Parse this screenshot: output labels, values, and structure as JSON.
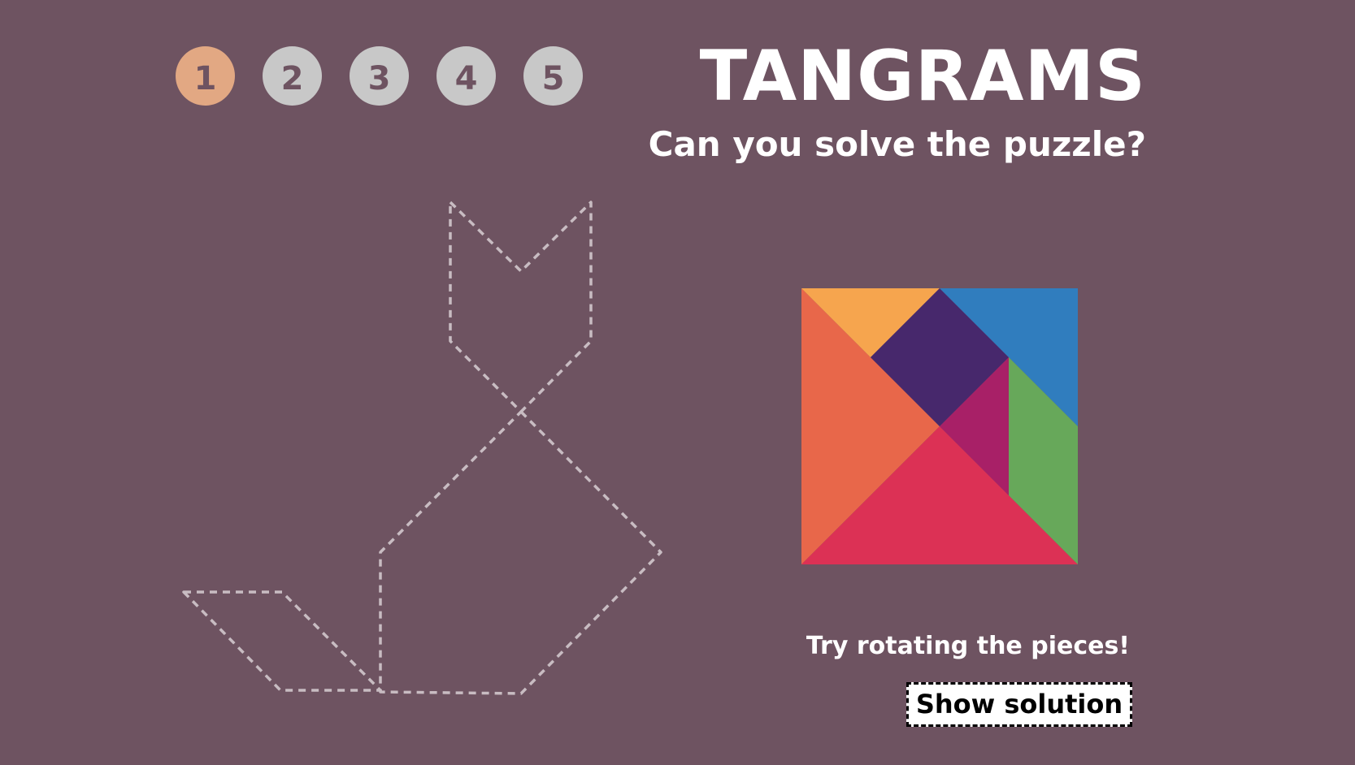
{
  "levels": [
    "1",
    "2",
    "3",
    "4",
    "5"
  ],
  "active_level": "1",
  "colors": {
    "background": "#6e5361",
    "level_active": "#e2a883",
    "level_inactive": "#c8c8c8",
    "outline": "#c8bcc2"
  },
  "header": {
    "title": "TANGRAMS",
    "subtitle": "Can you solve the puzzle?"
  },
  "hint": "Try rotating the pieces!",
  "show_solution_label": "Show solution",
  "pieces": [
    {
      "name": "large-triangle-orange",
      "color": "#e8674a"
    },
    {
      "name": "large-triangle-red",
      "color": "#dc3155"
    },
    {
      "name": "small-triangle-yellow",
      "color": "#f6a54e"
    },
    {
      "name": "square-purple",
      "color": "#47286c"
    },
    {
      "name": "medium-triangle-blue",
      "color": "#307dbe"
    },
    {
      "name": "small-triangle-magenta",
      "color": "#a82067"
    },
    {
      "name": "parallelogram-green",
      "color": "#67a85a"
    }
  ]
}
